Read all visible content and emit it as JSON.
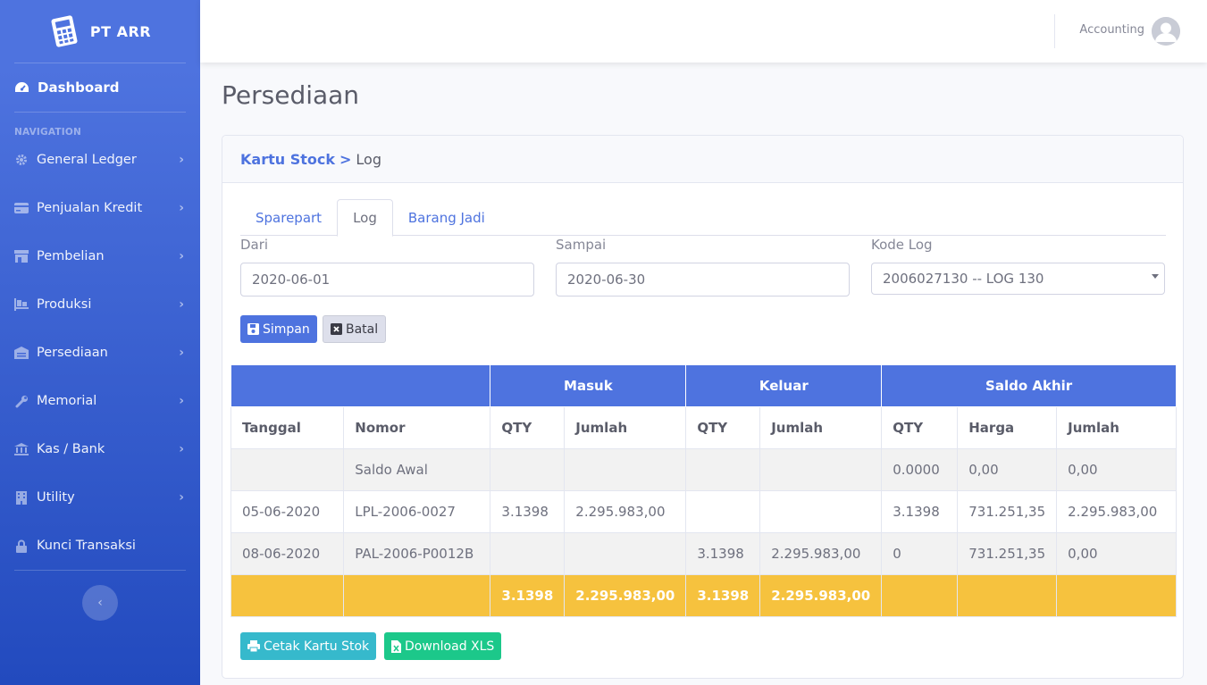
{
  "brand": {
    "name": "PT ARR"
  },
  "sidebar": {
    "dashboard": "Dashboard",
    "heading": "NAVIGATION",
    "items": [
      {
        "label": "General Ledger",
        "icon": "gear-icon"
      },
      {
        "label": "Penjualan Kredit",
        "icon": "credit-card-icon"
      },
      {
        "label": "Pembelian",
        "icon": "store-icon"
      },
      {
        "label": "Produksi",
        "icon": "pallet-icon"
      },
      {
        "label": "Persediaan",
        "icon": "warehouse-icon"
      },
      {
        "label": "Memorial",
        "icon": "wrench-icon"
      },
      {
        "label": "Kas / Bank",
        "icon": "bank-icon"
      },
      {
        "label": "Utility",
        "icon": "building-icon"
      },
      {
        "label": "Kunci Transaksi",
        "icon": "lock-icon"
      }
    ],
    "toggle": "‹"
  },
  "topbar": {
    "user": "Accounting"
  },
  "page": {
    "title": "Persediaan"
  },
  "card": {
    "breadcrumb_link": "Kartu Stock",
    "breadcrumb_sep": ">",
    "breadcrumb_current": "Log"
  },
  "tabs": [
    "Sparepart",
    "Log",
    "Barang Jadi"
  ],
  "form": {
    "dari_label": "Dari",
    "dari_value": "2020-06-01",
    "sampai_label": "Sampai",
    "sampai_value": "2020-06-30",
    "kode_label": "Kode Log",
    "kode_value": "2006027130 -- LOG 130"
  },
  "buttons": {
    "simpan": "Simpan",
    "batal": "Batal",
    "cetak": "Cetak Kartu Stok",
    "download": "Download XLS"
  },
  "table": {
    "groups": [
      "Masuk",
      "Keluar",
      "Saldo Akhir"
    ],
    "columns": [
      "Tanggal",
      "Nomor",
      "QTY",
      "Jumlah",
      "QTY",
      "Jumlah",
      "QTY",
      "Harga",
      "Jumlah"
    ],
    "rows": [
      [
        "",
        "Saldo Awal",
        "",
        "",
        "",
        "",
        "0.0000",
        "0,00",
        "0,00"
      ],
      [
        "05-06-2020",
        "LPL-2006-0027",
        "3.1398",
        "2.295.983,00",
        "",
        "",
        "3.1398",
        "731.251,35",
        "2.295.983,00"
      ],
      [
        "08-06-2020",
        "PAL-2006-P0012B",
        "",
        "",
        "3.1398",
        "2.295.983,00",
        "0",
        "731.251,35",
        "0,00"
      ]
    ],
    "total": [
      "",
      "",
      "3.1398",
      "2.295.983,00",
      "3.1398",
      "2.295.983,00",
      "",
      "",
      ""
    ]
  },
  "colors": {
    "primary": "#4e73df",
    "warning": "#f6c23e",
    "info": "#36b9cc",
    "success": "#1cc88a"
  }
}
